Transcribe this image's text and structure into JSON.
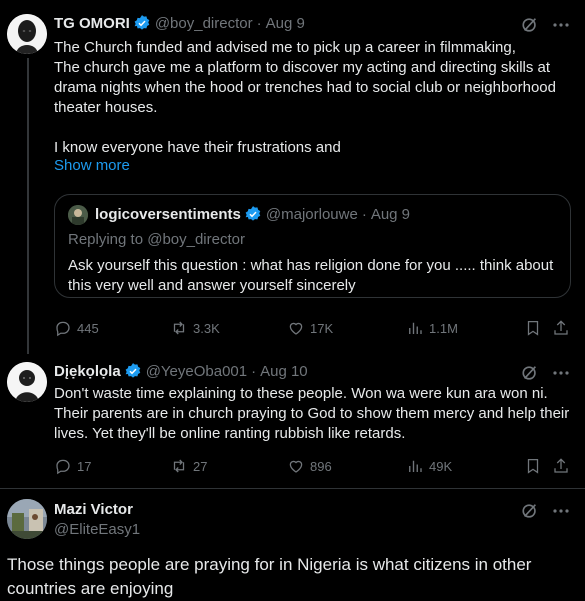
{
  "tweets": [
    {
      "name": "TG OMORI",
      "handle": "@boy_director",
      "date": "Aug 9",
      "text": "The Church funded and advised me to pick up a career in filmmaking,\nThe church gave me a platform to discover my acting and directing skills at drama nights when the hood or trenches had to social club or neighborhood theater houses.\n\nI know everyone have their frustrations and",
      "show_more": "Show more",
      "quote": {
        "name": "logicoversentiments",
        "handle": "@majorlouwe",
        "date": "Aug 9",
        "replying_to": "Replying to @boy_director",
        "text": "Ask yourself this question : what has religion done for you ..... think about this very well and answer yourself sincerely"
      },
      "stats": {
        "replies": "445",
        "reposts": "3.3K",
        "likes": "17K",
        "views": "1.1M"
      }
    },
    {
      "name": "Dįẹkọlọla",
      "handle": "@YeyeOba001",
      "date": "Aug 10",
      "text": "Don't waste time explaining to these people. Won wa were kun ara won ni. Their parents are in church praying to God to show them mercy and help their lives. Yet they'll be online ranting rubbish like retards.",
      "stats": {
        "replies": "17",
        "reposts": "27",
        "likes": "896",
        "views": "49K"
      }
    },
    {
      "name": "Mazi Victor",
      "handle": "@EliteEasy1",
      "text": "Those things people are praying for in Nigeria is what citizens in other countries are enjoying"
    }
  ],
  "colors": {
    "background": "#000000",
    "text": "#e7e9ea",
    "muted": "#71767b",
    "link": "#1d9bf0",
    "verified": "#1d9bf0"
  }
}
